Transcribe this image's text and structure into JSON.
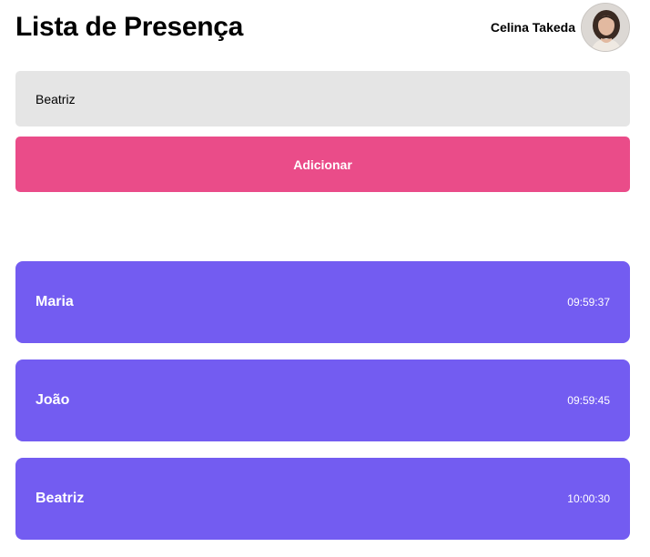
{
  "header": {
    "title": "Lista de Presença",
    "user_name": "Celina Takeda",
    "avatar_icon": "user-photo"
  },
  "form": {
    "input_value": "Beatriz",
    "button_label": "Adicionar"
  },
  "students": [
    {
      "name": "Maria",
      "time": "09:59:37"
    },
    {
      "name": "João",
      "time": "09:59:45"
    },
    {
      "name": "Beatriz",
      "time": "10:00:30"
    }
  ],
  "colors": {
    "accent": "#ea4c89",
    "card": "#735cf1",
    "input_bg": "#e5e5e5"
  }
}
